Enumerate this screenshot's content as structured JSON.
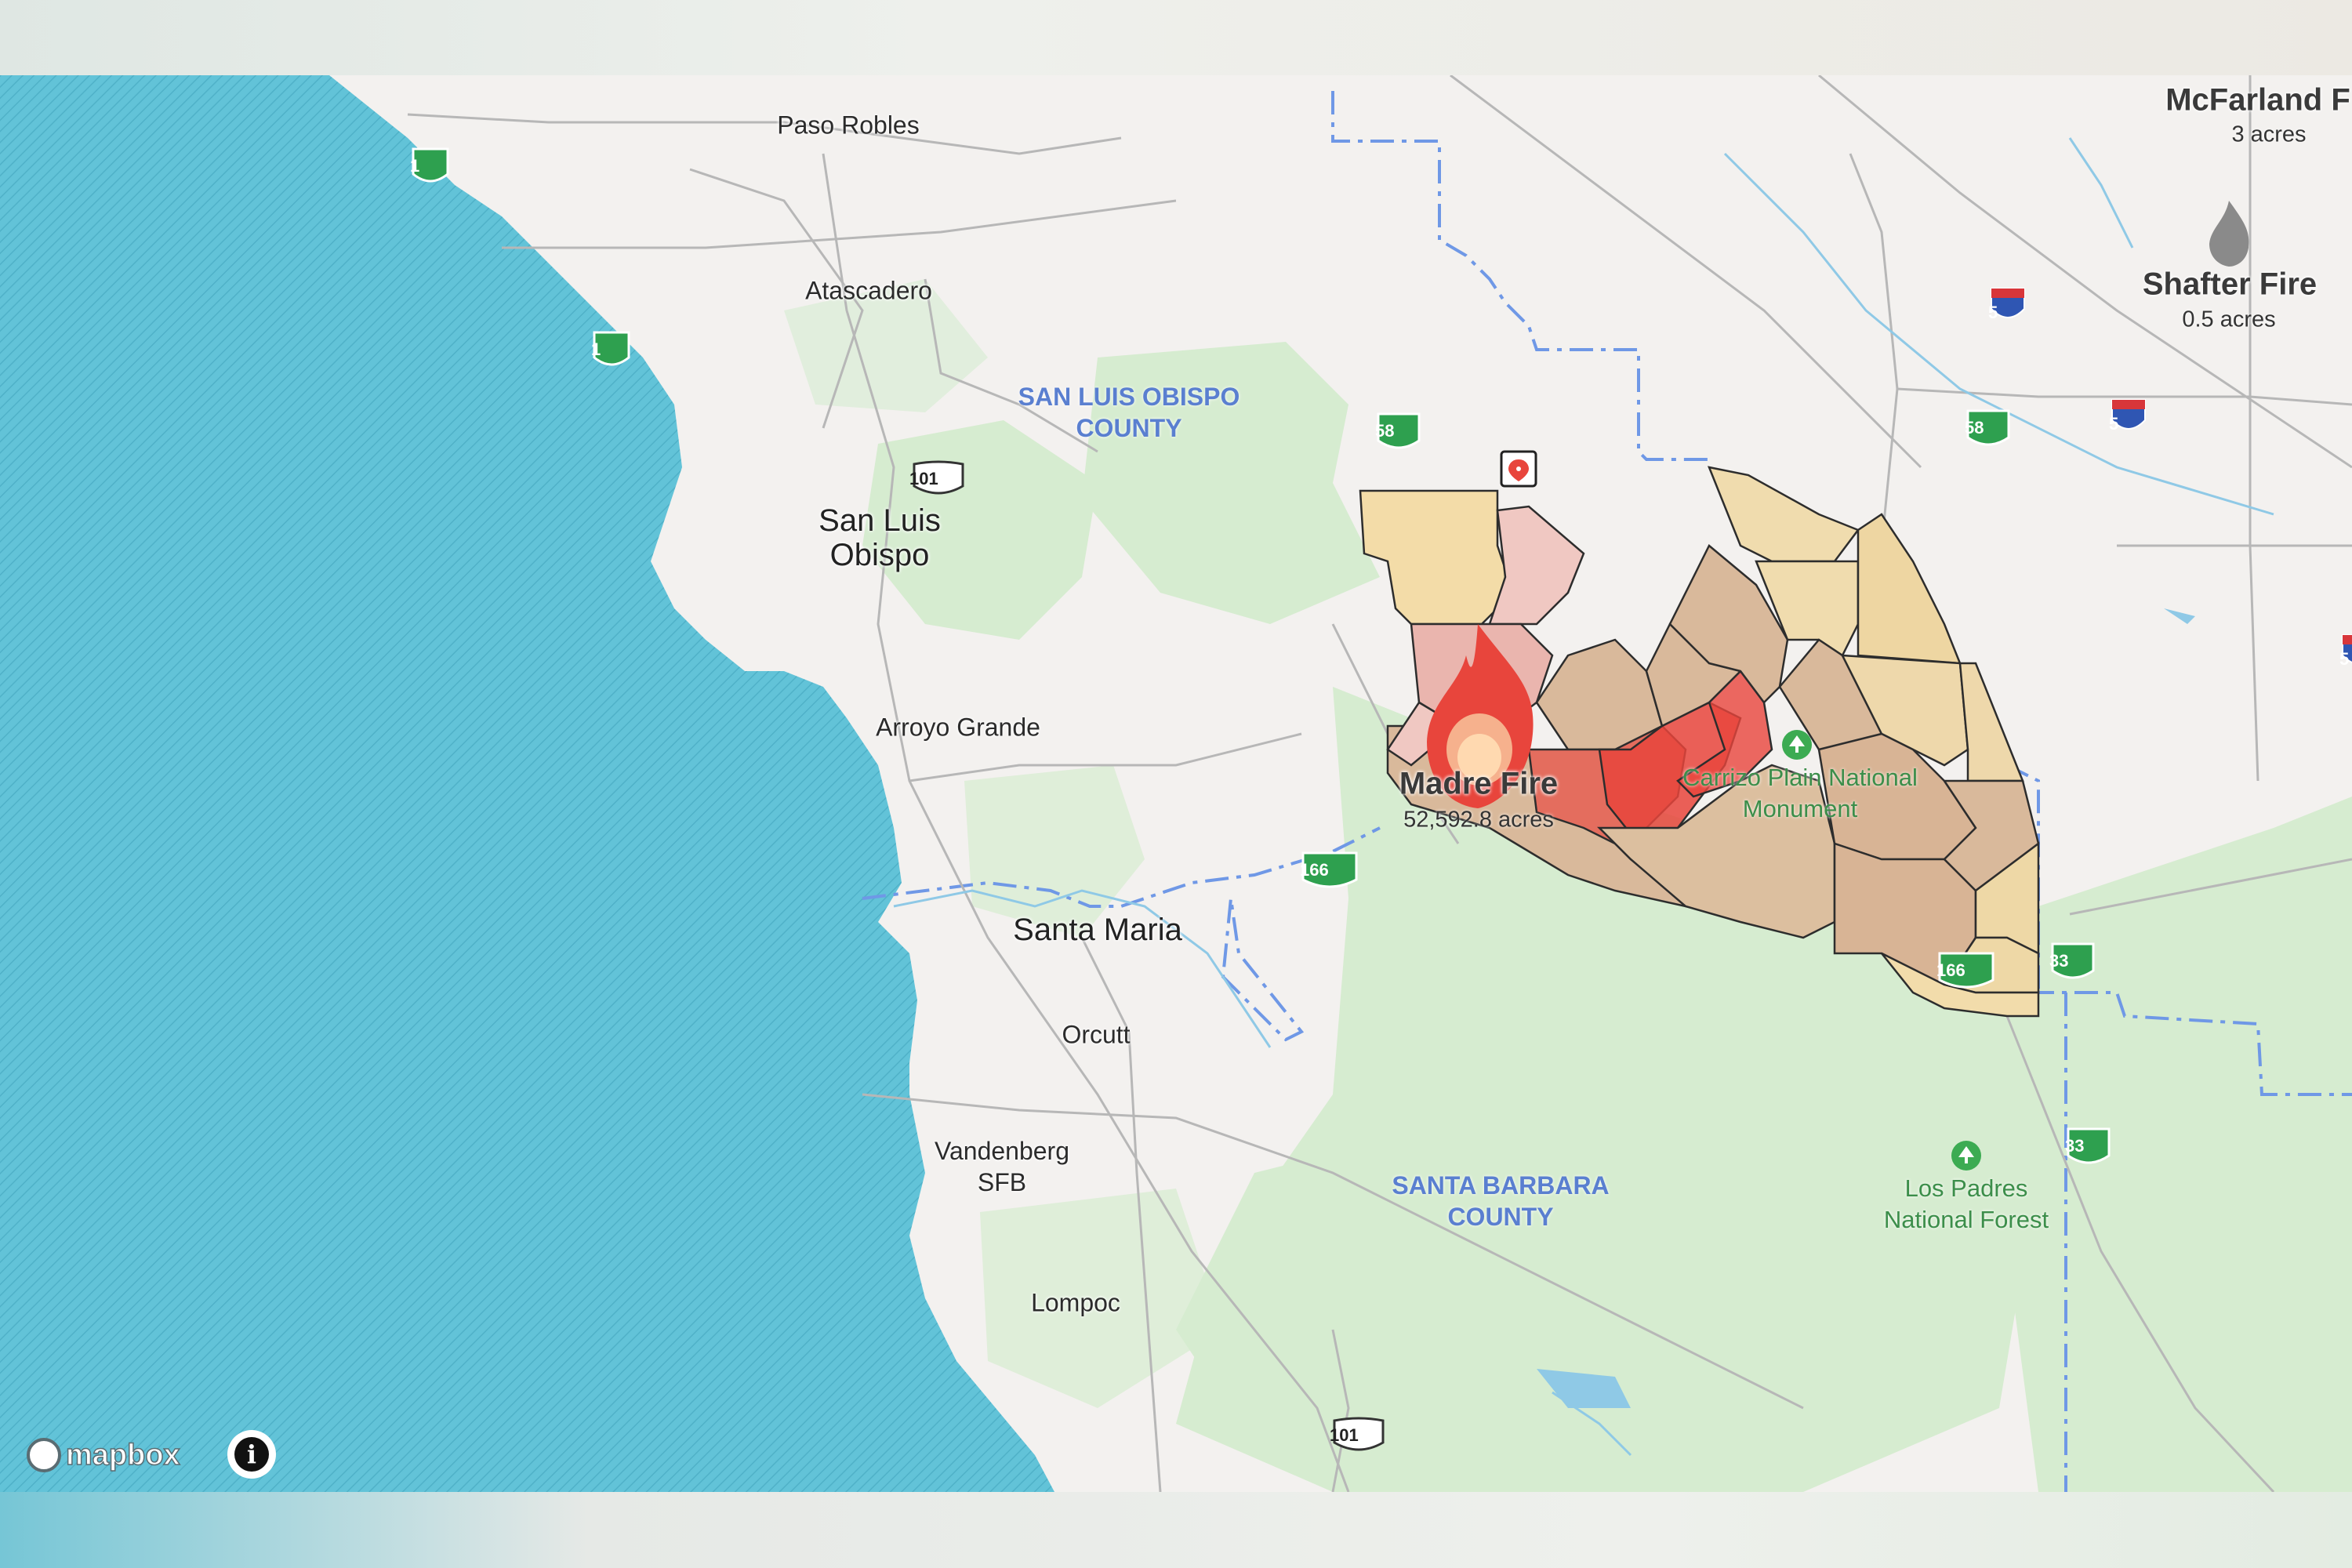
{
  "map": {
    "cities": {
      "paso_robles": "Paso Robles",
      "atascadero": "Atascadero",
      "san_luis_obispo": "San Luis\nObispo",
      "arroyo_grande": "Arroyo Grande",
      "santa_maria": "Santa Maria",
      "orcutt": "Orcutt",
      "vandenberg": "Vandenberg\nSFB",
      "lompoc": "Lompoc"
    },
    "counties": {
      "slo": "SAN LUIS OBISPO\nCOUNTY",
      "sb": "SANTA BARBARA\nCOUNTY"
    },
    "parks": {
      "carrizo": "Carrizo Plain National\nMonument",
      "los_padres": "Los Padres\nNational Forest"
    },
    "highways": {
      "hw1": "1",
      "hw58": "58",
      "hw166": "166",
      "hw33": "33",
      "us101": "101",
      "i5": "5"
    },
    "fires": {
      "madre": {
        "name": "Madre Fire",
        "acres": "52,592.8 acres"
      },
      "shafter": {
        "name": "Shafter Fire",
        "acres": "0.5 acres"
      },
      "mcfarland": {
        "name": "McFarland F",
        "acres": "3 acres"
      }
    },
    "attribution": {
      "logo": "mapbox",
      "info_icon": "i"
    },
    "colors": {
      "ocean": "#62c3d8",
      "land": "#f3f1ef",
      "park_green": "#cfe9c8",
      "fire_red": "#e8453c",
      "county_line": "#6f98e6",
      "zone_yellow": "#f3dca8",
      "zone_tan": "#d9b99b",
      "zone_pink": "#f0c0b8",
      "highway_green": "#2ea04f"
    }
  }
}
